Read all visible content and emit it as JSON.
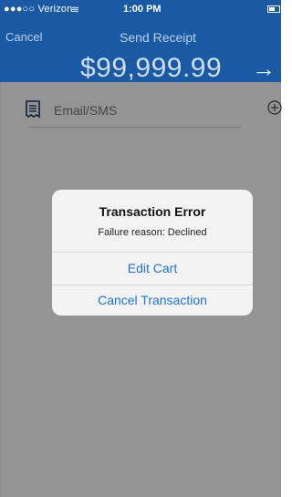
{
  "status_bar": {
    "carrier": "●●●○○ Verizon",
    "time": "1:00 PM"
  },
  "nav": {
    "cancel_label": "Cancel",
    "title": "Send Receipt"
  },
  "amount": "$99,999.99",
  "email_field": {
    "placeholder": "Email/SMS"
  },
  "alert": {
    "title": "Transaction Error",
    "message": "Failure reason: Declined",
    "edit_cart_label": "Edit Cart",
    "cancel_transaction_label": "Cancel Transaction"
  },
  "colors": {
    "header_blue": "#1a5aa5",
    "action_blue": "#1b72d9",
    "dim_overlay": "rgba(0,0,0,0.42)"
  },
  "icons": {
    "battery": "battery-icon",
    "wifi": "wifi-icon",
    "arrow": "arrow-right-icon",
    "receipt": "receipt-icon",
    "add": "add-circle-icon"
  }
}
